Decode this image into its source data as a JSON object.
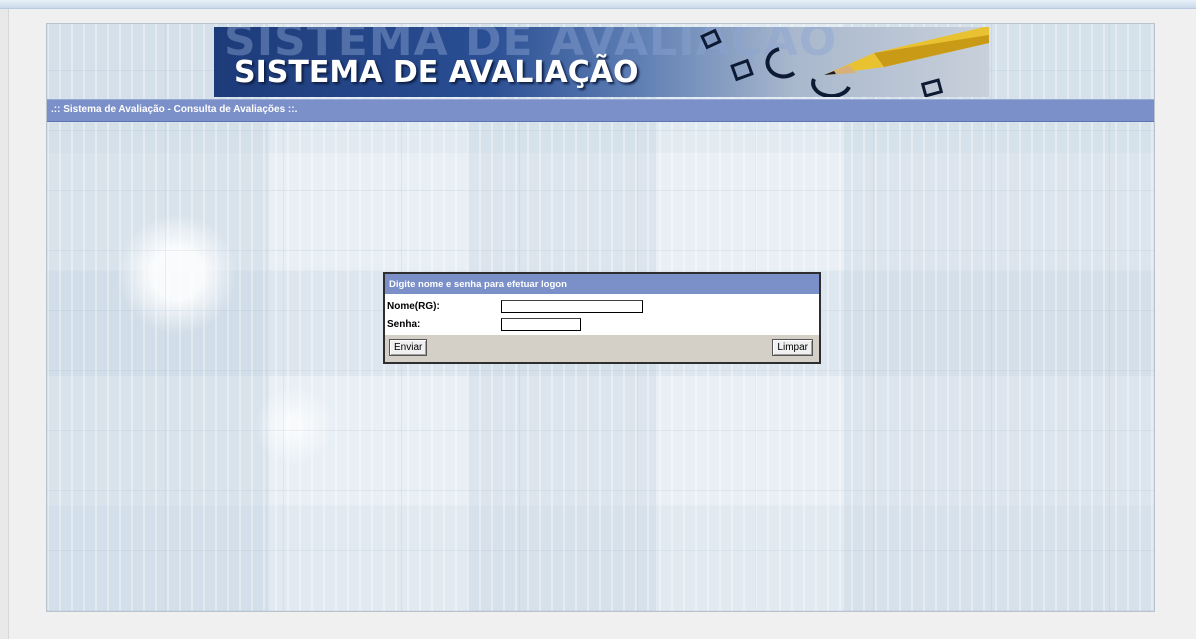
{
  "banner": {
    "title": "SISTEMA DE AVALIAÇÃO",
    "ghost_text": "SISTEMA DE AVALIAÇÃO"
  },
  "header": {
    "title": ".:: Sistema de Avaliação - Consulta de Avaliações ::."
  },
  "login": {
    "heading": "Digite nome e senha para efetuar logon",
    "username_label": "Nome(RG):",
    "username_value": "",
    "password_label": "Senha:",
    "password_value": "",
    "submit_label": "Enviar",
    "reset_label": "Limpar"
  },
  "colors": {
    "title_bar": "#7b8fc9",
    "banner_dark": "#1d3b79",
    "button_row": "#d4d0c8"
  }
}
